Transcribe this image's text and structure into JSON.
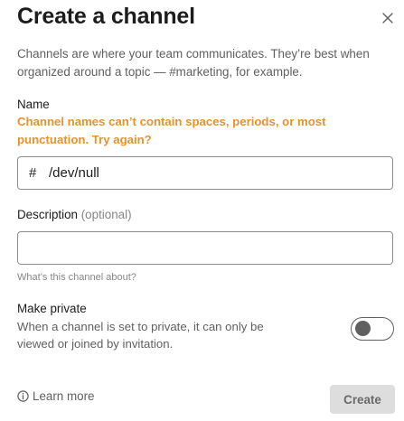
{
  "dialog": {
    "title": "Create a channel",
    "description": "Channels are where your team communicates. They’re best when organized around a topic — #marketing, for example."
  },
  "name_field": {
    "label": "Name",
    "error": "Channel names can’t contain spaces, periods, or most punctuation. Try again?",
    "prefix": "#",
    "value": "/dev/null"
  },
  "description_field": {
    "label": "Description",
    "optional": "(optional)",
    "value": "",
    "hint": "What’s this channel about?"
  },
  "private": {
    "label": "Make private",
    "text": "When a channel is set to private, it can only be viewed or joined by invitation.",
    "enabled": false
  },
  "footer": {
    "learn_more": "Learn more",
    "create_label": "Create"
  },
  "icons": {
    "close": "close-icon",
    "info": "info-icon"
  },
  "colors": {
    "error": "#e8912d",
    "text": "#1d1c1d",
    "muted": "#616061",
    "button_disabled_bg": "#dddddd"
  }
}
